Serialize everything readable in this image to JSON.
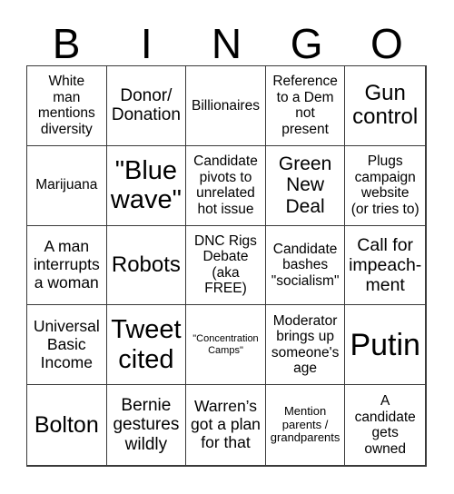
{
  "header": {
    "letters": [
      "B",
      "I",
      "N",
      "G",
      "O"
    ]
  },
  "cells": [
    {
      "text": "White\nman\nmentions\ndiversity"
    },
    {
      "text": "Donor/\nDonation"
    },
    {
      "text": "Billionaires"
    },
    {
      "text": "Reference\nto a Dem\nnot\npresent"
    },
    {
      "text": "Gun\ncontrol"
    },
    {
      "text": "Marijuana"
    },
    {
      "text": "\"Blue\nwave\""
    },
    {
      "text": "Candidate\npivots to\nunrelated\nhot issue"
    },
    {
      "text": "Green\nNew\nDeal"
    },
    {
      "text": "Plugs\ncampaign\nwebsite\n(or tries to)"
    },
    {
      "text": "A man\ninterrupts\na woman"
    },
    {
      "text": "Robots"
    },
    {
      "text": "DNC Rigs\nDebate\n(aka\nFREE)"
    },
    {
      "text": "Candidate\nbashes\n\"socialism\""
    },
    {
      "text": "Call for\nimpeach-\nment"
    },
    {
      "text": "Universal\nBasic\nIncome"
    },
    {
      "text": "Tweet\ncited"
    },
    {
      "text": "\"Concentration\nCamps\""
    },
    {
      "text": "Moderator\nbrings up\nsomeone's\nage"
    },
    {
      "text": "Putin"
    },
    {
      "text": "Bolton"
    },
    {
      "text": "Bernie\ngestures\nwildly"
    },
    {
      "text": "Warren’s\ngot a plan\nfor that"
    },
    {
      "text": "Mention\nparents /\ngrandparents"
    },
    {
      "text": "A\ncandidate\ngets\nowned"
    }
  ]
}
